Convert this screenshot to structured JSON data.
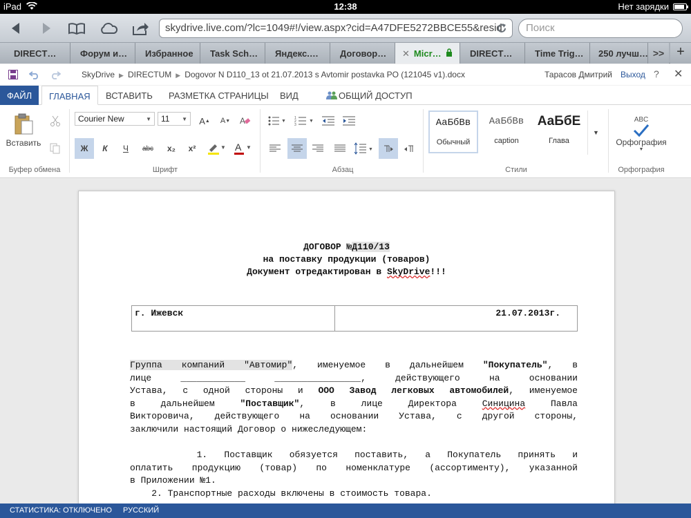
{
  "ios": {
    "device": "iPad",
    "time": "12:38",
    "battery_text": "Нет зарядки",
    "battery_level": 0.85
  },
  "safari": {
    "url": "skydrive.live.com/?lc=1049#!/view.aspx?cid=A47DFE5272BBCE55&resid",
    "search_placeholder": "Поиск"
  },
  "tabs": [
    {
      "label": "DIRECT…"
    },
    {
      "label": "Форум и…"
    },
    {
      "label": "Избранное"
    },
    {
      "label": "Task Sch…"
    },
    {
      "label": "Яндекс.…"
    },
    {
      "label": "Договор…"
    },
    {
      "label": "Micr…",
      "active": true
    },
    {
      "label": "DIRECT…"
    },
    {
      "label": "Time Trig…"
    },
    {
      "label": "250 лучш…"
    }
  ],
  "office": {
    "app": "SkyDrive",
    "folder": "DIRECTUM",
    "filename": "Dogovor N D110_13 ot 21.07.2013 s Avtomir postavka PO (121045 v1).docx",
    "user": "Тарасов Дмитрий",
    "logout": "Выход",
    "help": "?",
    "close": "✕"
  },
  "ribbon_tabs": [
    "ФАЙЛ",
    "ГЛАВНАЯ",
    "ВСТАВИТЬ",
    "РАЗМЕТКА СТРАНИЦЫ",
    "ВИД",
    "ОБЩИЙ ДОСТУП"
  ],
  "ribbon": {
    "paste_label": "Вставить",
    "clipboard_group": "Буфер обмена",
    "font_name": "Courier New",
    "font_size": "11",
    "font_group": "Шрифт",
    "bold": "Ж",
    "italic": "К",
    "underline": "Ч",
    "strike": "abc",
    "subscript": "x₂",
    "superscript": "x²",
    "paragraph_group": "Абзац",
    "styles": [
      {
        "sample": "АаБбВв",
        "label": "Обычный"
      },
      {
        "sample": "АаБбВв",
        "label": "caption"
      },
      {
        "sample": "АаБбЕ",
        "label": "Глава"
      }
    ],
    "styles_group": "Стили",
    "spelling_label": "Орфография",
    "spelling_group": "Орфография",
    "abc": "ABC"
  },
  "document": {
    "title_prefix": "ДОГОВОР №",
    "title_number": "Д110/13",
    "subtitle": "на поставку продукции (товаров)",
    "edited_prefix": "Документ отредактирован в ",
    "edited_word": "SkyDrive",
    "edited_suffix": "!!!",
    "city": "г. Ижевск",
    "date": "21.07.2013г.",
    "p1": {
      "l1_hl": "Группа компаний \"Автомир\"",
      "l1_a": ", именуемое в дальнейшем ",
      "l1_b": "\"Покупатель\"",
      "l1_c": ", в",
      "l2": "лице ____________ ________________, действующего на основании",
      "l3_a": "Устава, с одной стороны и ",
      "l3_b": "ООО Завод легковых автомобилей",
      "l3_c": ", именуемое",
      "l4_a": "в дальнейшем ",
      "l4_b": "\"Поставщик\"",
      "l4_c": ", в лице Директора ",
      "l4_d": "Синицина",
      "l4_e": " Павла",
      "l5": "Викторовича, действующего на основании Устава, с другой стороны,",
      "l6": "заключили настоящий Договор о нижеследующем:"
    },
    "item1_l1": "    1. Поставщик обязуется поставить, а Покупатель принять и",
    "item1_l2": "оплатить продукцию (товар) по номенклатуре (ассортименту), указанной",
    "item1_l3": "в Приложении №1.",
    "item2": "    2. Транспортные расходы включены в стоимость товара."
  },
  "footer": {
    "stats": "СТАТИСТИКА: ОТКЛЮЧЕНО",
    "lang": "РУССКИЙ"
  },
  "colors": {
    "accent": "#2b579a",
    "active_tab": "#1e8a1e"
  }
}
